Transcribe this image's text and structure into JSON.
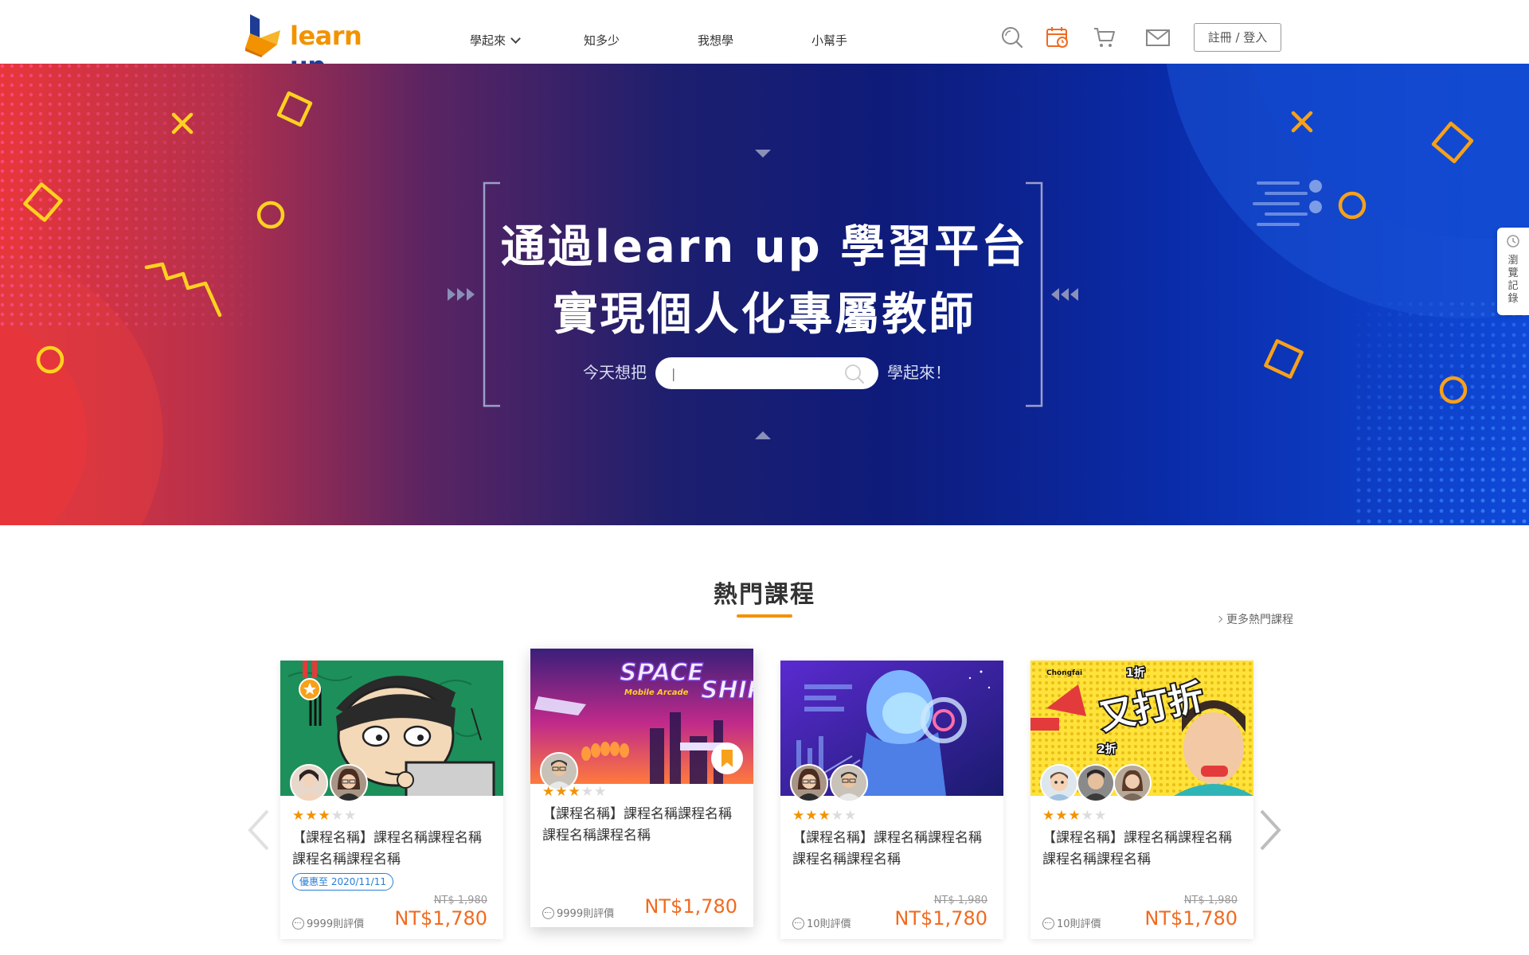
{
  "brand": {
    "logo_learn": "learn",
    "logo_up": " up",
    "accent": "#f39200",
    "navy": "#1e3c96"
  },
  "nav": {
    "items": [
      {
        "label": "學起來",
        "has_dropdown": true
      },
      {
        "label": "知多少"
      },
      {
        "label": "我想學"
      },
      {
        "label": "小幫手"
      }
    ],
    "icons": [
      "search-icon",
      "calendar-icon",
      "cart-icon",
      "mail-icon"
    ],
    "auth_label": "註冊 / 登入"
  },
  "hero": {
    "title_line1": "通過learn up 學習平台",
    "title_line2": "實現個人化專屬教師",
    "lead": "今天想把",
    "tail": "學起來！",
    "search_value": "",
    "search_placeholder": "|"
  },
  "history_tab": {
    "label": "瀏覽記錄"
  },
  "section": {
    "title": "熱門課程",
    "more_label": "更多熱門課程"
  },
  "courses": [
    {
      "title": "【課程名稱】課程名稱課程名稱課程名稱課程名稱",
      "rating": 3,
      "promo": "優惠至 2020/11/11",
      "old_price": "NT$ 1,980",
      "price": "NT$1,780",
      "reviews": "9999則評價",
      "avatar_count": 2,
      "featured": false
    },
    {
      "title": "【課程名稱】課程名稱課程名稱課程名稱課程名稱",
      "rating": 3,
      "promo": "",
      "old_price": "",
      "price": "NT$1,780",
      "reviews": "9999則評價",
      "avatar_count": 1,
      "featured": true,
      "thumb_text_1": "SPACE",
      "thumb_text_2": "Mobile Arcade",
      "thumb_text_3": "SHIP"
    },
    {
      "title": "【課程名稱】課程名稱課程名稱課程名稱課程名稱",
      "rating": 3,
      "promo": "",
      "old_price": "NT$ 1,980",
      "price": "NT$1,780",
      "reviews": "10則評價",
      "avatar_count": 2,
      "featured": false
    },
    {
      "title": "【課程名稱】課程名稱課程名稱課程名稱課程名稱",
      "rating": 3,
      "promo": "",
      "old_price": "NT$ 1,980",
      "price": "NT$1,780",
      "reviews": "10則評價",
      "avatar_count": 3,
      "featured": false,
      "thumb_text_1": "又打折",
      "thumb_text_2": "1折",
      "thumb_text_3": "2折",
      "thumb_text_4": "Chongfai"
    }
  ]
}
